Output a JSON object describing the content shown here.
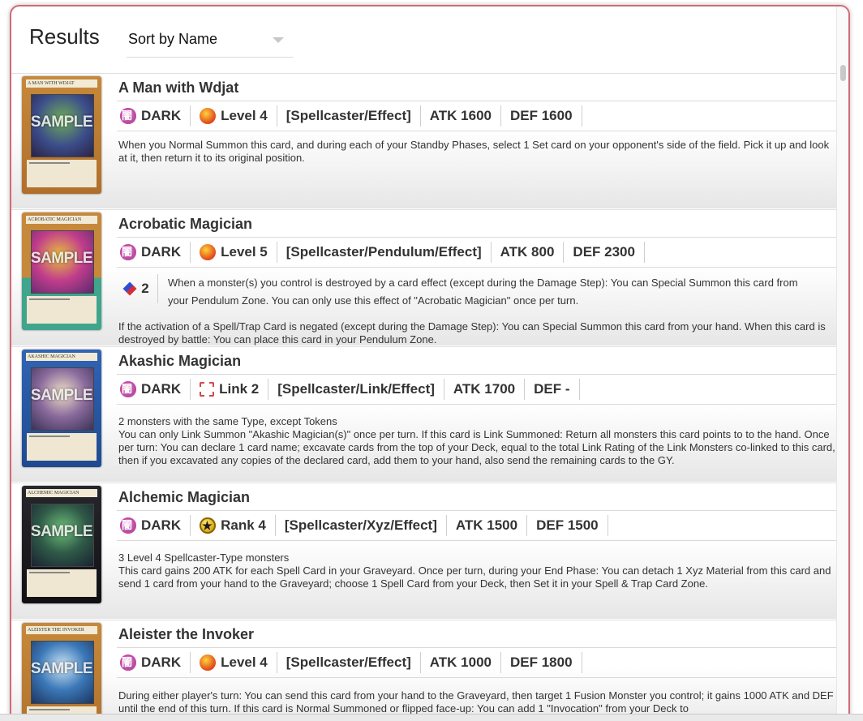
{
  "header": {
    "title": "Results",
    "sort_label": "Sort by Name"
  },
  "cards": [
    {
      "name": "A Man with Wdjat",
      "thumb_label": "A MAN WITH WDJAT",
      "attribute": "DARK",
      "level": "Level 4",
      "type": "[Spellcaster/Effect]",
      "atk": "ATK 1600",
      "def": "DEF 1600",
      "description": "When you Normal Summon this card, and during each of your Standby Phases, select 1 Set card on your opponent's side of the field. Pick it up and look at it, then return it to its original position."
    },
    {
      "name": "Acrobatic Magician",
      "thumb_label": "ACROBATIC MAGICIAN",
      "attribute": "DARK",
      "level": "Level 5",
      "type": "[Spellcaster/Pendulum/Effect]",
      "atk": "ATK 800",
      "def": "DEF 2300",
      "pendulum_scale": "2",
      "pendulum_effect": "When a monster(s) you control is destroyed by a card effect (except during the Damage Step): You can Special Summon this card from your Pendulum Zone. You can only use this effect of \"Acrobatic Magician\" once per turn.",
      "description": "If the activation of a Spell/Trap Card is negated (except during the Damage Step): You can Special Summon this card from your hand. When this card is destroyed by battle: You can place this card in your Pendulum Zone."
    },
    {
      "name": "Akashic Magician",
      "thumb_label": "AKASHIC MAGICIAN",
      "attribute": "DARK",
      "level": "Link 2",
      "type": "[Spellcaster/Link/Effect]",
      "atk": "ATK 1700",
      "def": "DEF -",
      "materials": "2 monsters with the same Type, except Tokens",
      "description": "You can only Link Summon \"Akashic Magician(s)\" once per turn. If this card is Link Summoned: Return all monsters this card points to to the hand. Once per turn: You can declare 1 card name; excavate cards from the top of your Deck, equal to the total Link Rating of the Link Monsters co-linked to this card, then if you excavated any copies of the declared card, add them to your hand, also send the remaining cards to the GY."
    },
    {
      "name": "Alchemic Magician",
      "thumb_label": "ALCHEMIC MAGICIAN",
      "attribute": "DARK",
      "level": "Rank 4",
      "type": "[Spellcaster/Xyz/Effect]",
      "atk": "ATK 1500",
      "def": "DEF 1500",
      "materials": "3 Level 4 Spellcaster-Type monsters",
      "description": "This card gains 200 ATK for each Spell Card in your Graveyard. Once per turn, during your End Phase: You can detach 1 Xyz Material from this card and send 1 card from your hand to the Graveyard; choose 1 Spell Card from your Deck, then Set it in your Spell & Trap Card Zone."
    },
    {
      "name": "Aleister the Invoker",
      "thumb_label": "ALEISTER THE INVOKER",
      "attribute": "DARK",
      "level": "Level 4",
      "type": "[Spellcaster/Effect]",
      "atk": "ATK 1000",
      "def": "DEF 1800",
      "description": "During either player's turn: You can send this card from your hand to the Graveyard, then target 1 Fusion Monster you control; it gains 1000 ATK and DEF until the end of this turn. If this card is Normal Summoned or flipped face-up: You can add 1 \"Invocation\" from your Deck to"
    }
  ],
  "watermark": "SAMPLE"
}
